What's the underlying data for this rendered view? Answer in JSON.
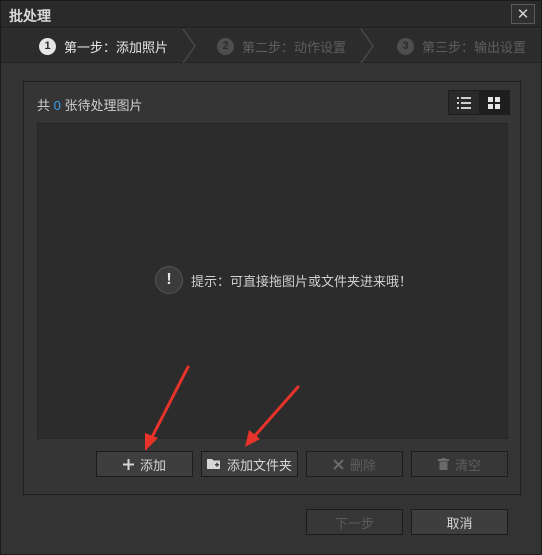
{
  "window": {
    "title": "批处理",
    "close_glyph": "✕"
  },
  "steps": [
    {
      "num": "1",
      "label": "第一步：添加照片",
      "active": true
    },
    {
      "num": "2",
      "label": "第二步：动作设置",
      "active": false
    },
    {
      "num": "3",
      "label": "第三步：输出设置",
      "active": false
    }
  ],
  "summary": {
    "prefix": "共",
    "count": "0",
    "suffix": "张待处理图片"
  },
  "hint": {
    "icon": "!",
    "text": "提示：可直接拖图片或文件夹进来哦！"
  },
  "actions": {
    "add": "添加",
    "add_folder": "添加文件夹",
    "delete": "删除",
    "clear": "清空"
  },
  "footer": {
    "next": "下一步",
    "cancel": "取消"
  },
  "colors": {
    "accent_blue": "#3a9ee8",
    "annotation_red": "#e8332a"
  }
}
